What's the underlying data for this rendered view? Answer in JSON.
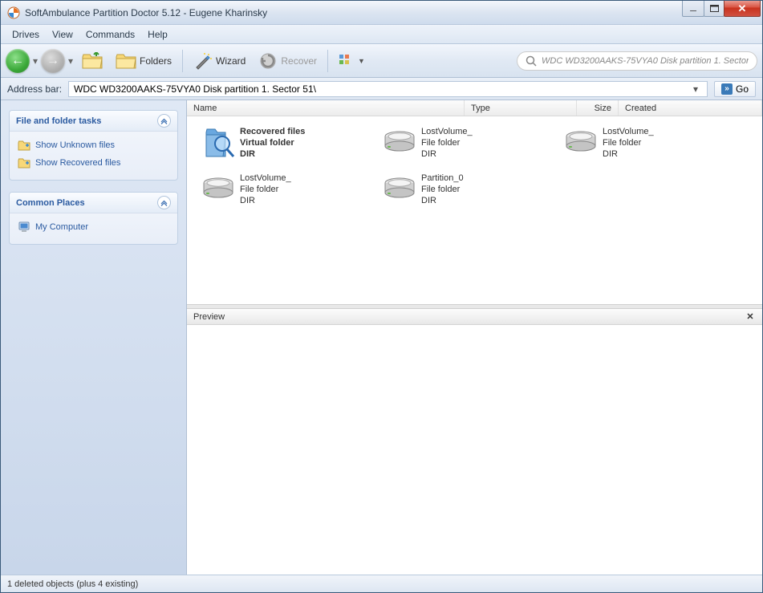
{
  "window": {
    "title": "SoftAmbulance Partition Doctor 5.12 - Eugene Kharinsky"
  },
  "menu": {
    "items": [
      "Drives",
      "View",
      "Commands",
      "Help"
    ]
  },
  "toolbar": {
    "folders_label": "Folders",
    "wizard_label": "Wizard",
    "recover_label": "Recover",
    "search_placeholder": "WDC WD3200AAKS-75VYA0 Disk partition 1. Sector 5"
  },
  "address": {
    "label": "Address bar:",
    "path": "WDC WD3200AAKS-75VYA0 Disk partition 1. Sector 51\\",
    "go_label": "Go"
  },
  "sidebar": {
    "tasks": {
      "title": "File and folder tasks",
      "links": [
        {
          "label": "Show Unknown files"
        },
        {
          "label": "Show Recovered files"
        }
      ]
    },
    "places": {
      "title": "Common Places",
      "links": [
        {
          "label": "My Computer"
        }
      ]
    }
  },
  "columns": {
    "name": "Name",
    "type": "Type",
    "size": "Size",
    "created": "Created"
  },
  "items": [
    {
      "line1": "Recovered files",
      "line2": "Virtual folder",
      "line3": "DIR",
      "icon": "magnify",
      "bold": true
    },
    {
      "line1": "LostVolume_",
      "line2": "File folder",
      "line3": "DIR",
      "icon": "drive"
    },
    {
      "line1": "LostVolume_",
      "line2": "File folder",
      "line3": "DIR",
      "icon": "drive"
    },
    {
      "line1": "LostVolume_",
      "line2": "File folder",
      "line3": "DIR",
      "icon": "drive"
    },
    {
      "line1": "Partition_0",
      "line2": "File folder",
      "line3": "DIR",
      "icon": "drive"
    }
  ],
  "preview": {
    "title": "Preview"
  },
  "status": {
    "text": "1 deleted objects (plus 4 existing)"
  }
}
